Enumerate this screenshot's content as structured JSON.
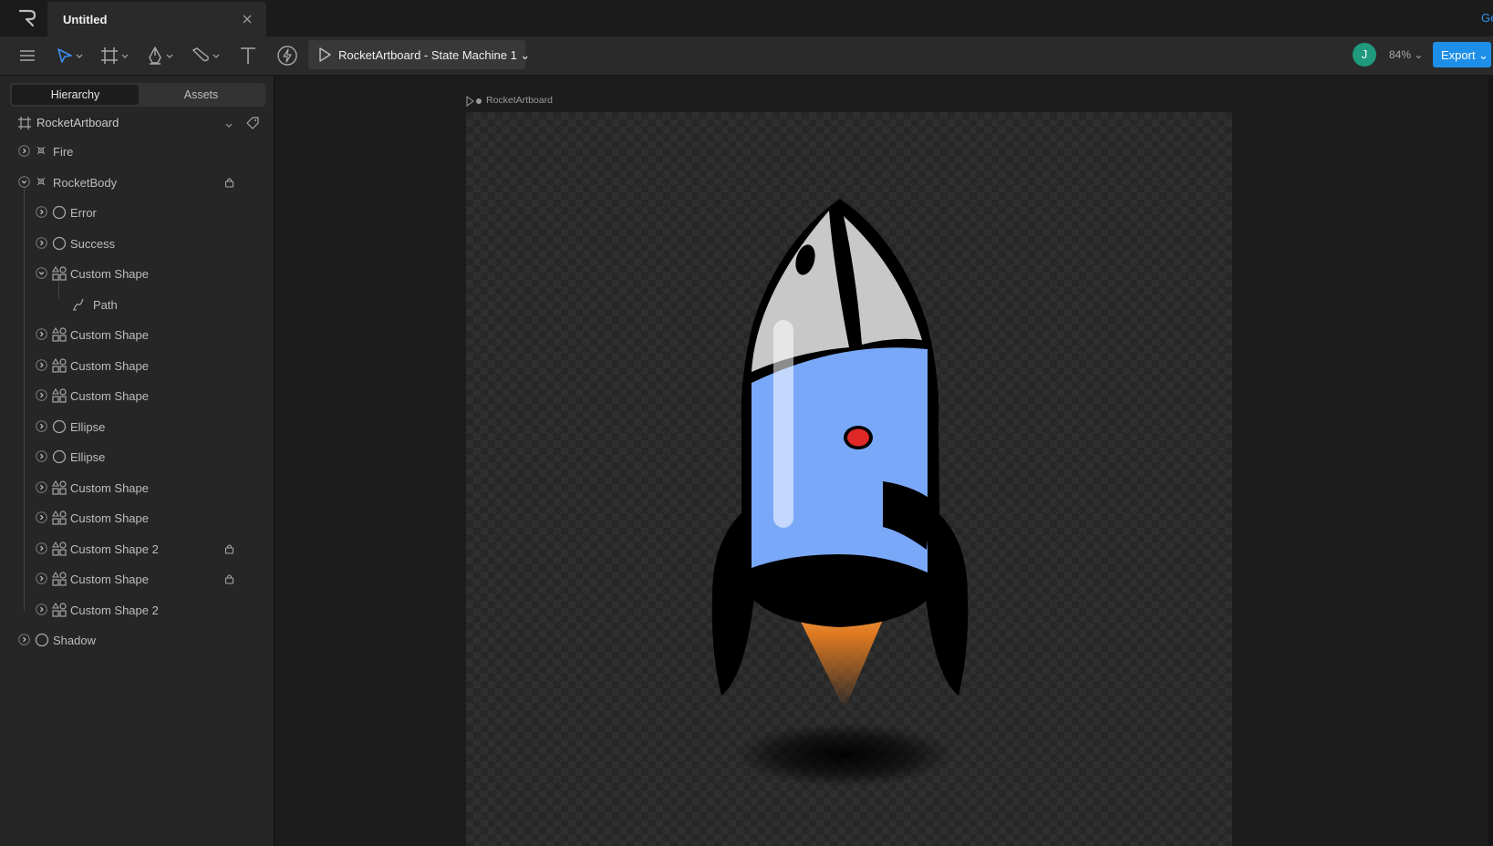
{
  "tabbar": {
    "document_title": "Untitled",
    "right_link": "Ge"
  },
  "toolbar": {
    "play_menu_label": "RocketArtboard - State Machine 1 ⌄",
    "avatar_initial": "J",
    "zoom": "84% ⌄",
    "export_label": "Export ⌄"
  },
  "panel": {
    "tabs": [
      "Hierarchy",
      "Assets"
    ],
    "active_tab": "Hierarchy",
    "artboard": "RocketArtboard",
    "layers": [
      {
        "label": "Fire",
        "type": "group",
        "depth": 0,
        "expanded": false,
        "locked": false
      },
      {
        "label": "RocketBody",
        "type": "group",
        "depth": 0,
        "expanded": true,
        "locked": true
      },
      {
        "label": "Error",
        "type": "ellipse",
        "depth": 1,
        "expanded": false,
        "locked": false
      },
      {
        "label": "Success",
        "type": "ellipse",
        "depth": 1,
        "expanded": false,
        "locked": false
      },
      {
        "label": "Custom Shape",
        "type": "shape",
        "depth": 1,
        "expanded": true,
        "locked": false
      },
      {
        "label": "Path",
        "type": "path",
        "depth": 2,
        "expanded": false,
        "locked": false
      },
      {
        "label": "Custom Shape",
        "type": "shape",
        "depth": 1,
        "expanded": false,
        "locked": false
      },
      {
        "label": "Custom Shape",
        "type": "shape",
        "depth": 1,
        "expanded": false,
        "locked": false
      },
      {
        "label": "Custom Shape",
        "type": "shape",
        "depth": 1,
        "expanded": false,
        "locked": false
      },
      {
        "label": "Ellipse",
        "type": "ellipse",
        "depth": 1,
        "expanded": false,
        "locked": false
      },
      {
        "label": "Ellipse",
        "type": "ellipse",
        "depth": 1,
        "expanded": false,
        "locked": false
      },
      {
        "label": "Custom Shape",
        "type": "shape",
        "depth": 1,
        "expanded": false,
        "locked": false
      },
      {
        "label": "Custom Shape",
        "type": "shape",
        "depth": 1,
        "expanded": false,
        "locked": false
      },
      {
        "label": "Custom Shape 2",
        "type": "shape",
        "depth": 1,
        "expanded": false,
        "locked": true
      },
      {
        "label": "Custom Shape",
        "type": "shape",
        "depth": 1,
        "expanded": false,
        "locked": true
      },
      {
        "label": "Custom Shape 2",
        "type": "shape",
        "depth": 1,
        "expanded": false,
        "locked": false
      },
      {
        "label": "Shadow",
        "type": "ellipse",
        "depth": 0,
        "expanded": false,
        "locked": false
      }
    ]
  },
  "canvas": {
    "artboard_label": "RocketArtboard"
  },
  "colors": {
    "accent": "#1e8fe8",
    "avatar": "#1f9a7c",
    "rocket_body": "#7aa8f8",
    "rocket_nose": "#c8c8c8",
    "porthole": "#e02828"
  }
}
